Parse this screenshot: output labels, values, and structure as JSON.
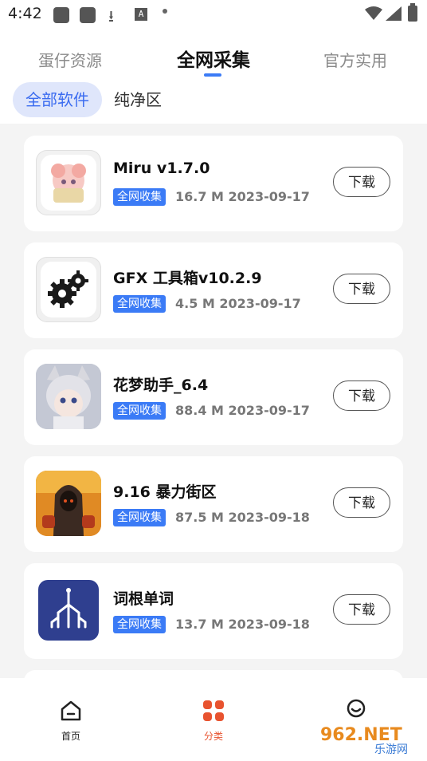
{
  "status_bar": {
    "time": "4:42",
    "input_glyph": "A"
  },
  "tabs": [
    {
      "label": "蛋仔资源"
    },
    {
      "label": "全网采集"
    },
    {
      "label": "官方实用"
    }
  ],
  "filters": [
    {
      "label": "全部软件"
    },
    {
      "label": "纯净区"
    }
  ],
  "apps": [
    {
      "name": "Miru v1.7.0",
      "badge": "全网收集",
      "meta": "16.7 M 2023-09-17",
      "button": "下载",
      "icon": "anime-girl-icon"
    },
    {
      "name": "GFX 工具箱v10.2.9",
      "badge": "全网收集",
      "meta": "4.5 M 2023-09-17",
      "button": "下载",
      "icon": "gears-icon"
    },
    {
      "name": "花梦助手_6.4",
      "badge": "全网收集",
      "meta": "88.4 M 2023-09-17",
      "button": "下载",
      "icon": "catgirl-icon"
    },
    {
      "name": "9.16 暴力街区",
      "badge": "全网收集",
      "meta": "87.5 M 2023-09-18",
      "button": "下载",
      "icon": "hooded-fighter-icon"
    },
    {
      "name": "词根单词",
      "badge": "全网收集",
      "meta": "13.7 M 2023-09-18",
      "button": "下载",
      "icon": "word-tree-icon"
    }
  ],
  "bottom_nav": [
    {
      "label": "首页",
      "icon": "home-icon"
    },
    {
      "label": "分类",
      "icon": "category-icon"
    },
    {
      "label": "",
      "icon": "profile-icon"
    }
  ],
  "watermark": {
    "text_top": "962.NET",
    "text_bottom": "乐游网"
  },
  "colors": {
    "accent": "#3b7bf6",
    "nav_active": "#e8532f",
    "chip_bg": "#dfe6fb"
  }
}
